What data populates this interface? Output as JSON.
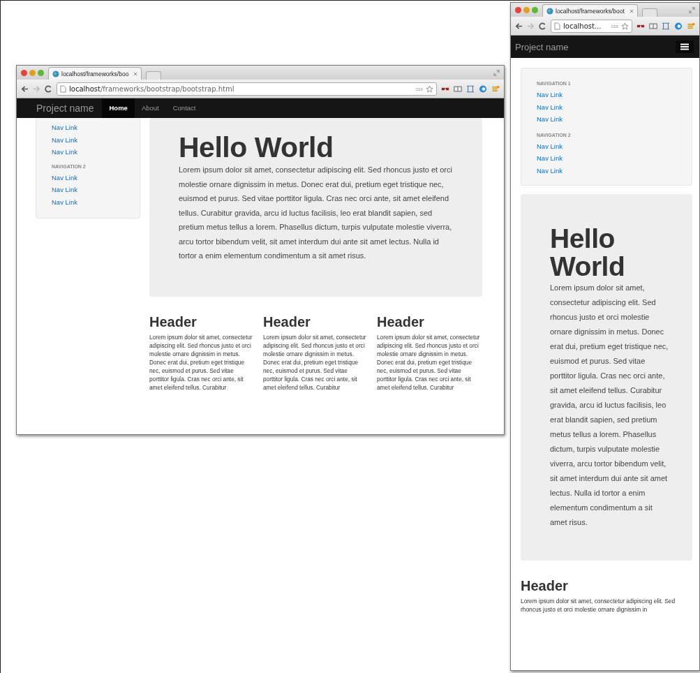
{
  "left_window": {
    "tab_title": "localhost/frameworks/boo",
    "url_host": "localhost",
    "url_path": "/frameworks/bootstrap/bootstrap.html",
    "extension_badge": "css",
    "navbar": {
      "brand": "Project name",
      "items": [
        {
          "label": "Home",
          "selected": true
        },
        {
          "label": "About",
          "selected": false
        },
        {
          "label": "Contact",
          "selected": false
        }
      ]
    },
    "sidebar": {
      "groups": [
        {
          "links": [
            "Nav Link",
            "Nav Link",
            "Nav Link"
          ]
        },
        {
          "heading": "NAVIGATION 2",
          "links": [
            "Nav Link",
            "Nav Link",
            "Nav Link"
          ]
        }
      ]
    },
    "hero": {
      "title": "Hello World",
      "text": "Lorem ipsum dolor sit amet, consectetur adipiscing elit. Sed rhoncus justo et orci molestie ornare dignissim in metus. Donec erat dui, pretium eget tristique nec, euismod et purus. Sed vitae porttitor ligula. Cras nec orci ante, sit amet eleifend tellus. Curabitur gravida, arcu id luctus facilisis, leo erat blandit sapien, sed pretium metus tellus a lorem. Phasellus dictum, turpis vulputate molestie viverra, arcu tortor bibendum velit, sit amet interdum dui ante sit amet lectus. Nulla id tortor a enim elementum condimentum a sit amet risus."
    },
    "columns": [
      {
        "header": "Header",
        "text": "Lorem ipsum dolor sit amet, consectetur adipiscing elit. Sed rhoncus justo et orci molestie ornare dignissim in metus. Donec erat dui, pretium eget tristique nec, euismod et purus. Sed vitae porttitor ligula. Cras nec orci ante, sit amet eleifend tellus. Curabitur"
      },
      {
        "header": "Header",
        "text": "Lorem ipsum dolor sit amet, consectetur adipiscing elit. Sed rhoncus justo et orci molestie ornare dignissim in metus. Donec erat dui, pretium eget tristique nec, euismod et purus. Sed vitae porttitor ligula. Cras nec orci ante, sit amet eleifend tellus. Curabitur"
      },
      {
        "header": "Header",
        "text": "Lorem ipsum dolor sit amet, consectetur adipiscing elit. Sed rhoncus justo et orci molestie ornare dignissim in metus. Donec erat dui, pretium eget tristique nec, euismod et purus. Sed vitae porttitor ligula. Cras nec orci ante, sit amet eleifend tellus. Curabitur"
      }
    ]
  },
  "right_window": {
    "tab_title": "localhost/frameworks/boot",
    "url": "localhost...",
    "extension_badge": "css",
    "navbar": {
      "brand": "Project name"
    },
    "sidebar": {
      "groups": [
        {
          "heading": "NAVIGATION 1",
          "links": [
            "Nav Link",
            "Nav Link",
            "Nav Link"
          ]
        },
        {
          "heading": "NAVIGATION 2",
          "links": [
            "Nav Link",
            "Nav Link",
            "Nav Link"
          ]
        }
      ]
    },
    "hero": {
      "title": "Hello World",
      "text": "Lorem ipsum dolor sit amet, consectetur adipiscing elit. Sed rhoncus justo et orci molestie ornare dignissim in metus. Donec erat dui, pretium eget tristique nec, euismod et purus. Sed vitae porttitor ligula. Cras nec orci ante, sit amet eleifend tellus. Curabitur gravida, arcu id luctus facilisis, leo erat blandit sapien, sed pretium metus tellus a lorem. Phasellus dictum, turpis vulputate molestie viverra, arcu tortor bibendum velit, sit amet interdum dui ante sit amet lectus. Nulla id tortor a enim elementum condimentum a sit amet risus."
    },
    "columns": [
      {
        "header": "Header",
        "text": "Lorem ipsum dolor sit amet, consectetur adipiscing elit. Sed rhoncus justo et orci molestie ornare dignissim in"
      }
    ]
  }
}
